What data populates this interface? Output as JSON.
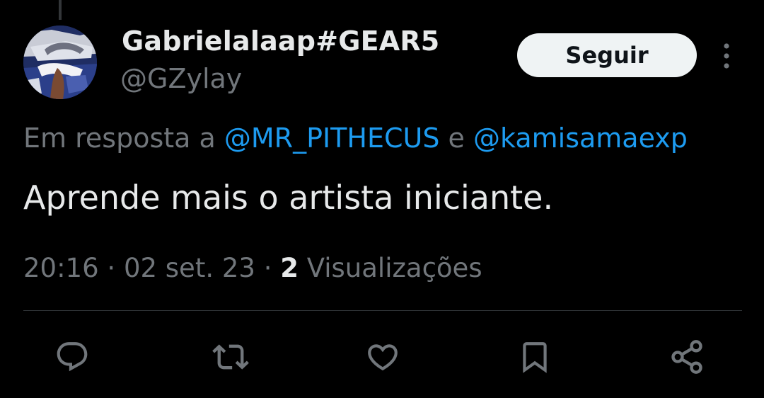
{
  "author": {
    "display_name": "Gabrielalaap#GEAR5",
    "handle": "@GZylay",
    "avatar_icon": "avatar-image"
  },
  "header": {
    "follow_label": "Seguir",
    "more_icon": "more-vertical-icon"
  },
  "reply_context": {
    "prefix": "Em resposta a ",
    "mention_1": "@MR_PITHECUS",
    "conjunction": " e ",
    "mention_2": "@kamisamaexp"
  },
  "tweet": {
    "text": "Aprende mais o artista iniciante."
  },
  "meta": {
    "time": "20:16",
    "separator": " · ",
    "date": "02 set. 23",
    "views_count": "2",
    "views_label": " Visualizações"
  },
  "actions": [
    {
      "name": "reply",
      "icon": "reply-icon"
    },
    {
      "name": "retweet",
      "icon": "retweet-icon"
    },
    {
      "name": "like",
      "icon": "heart-icon"
    },
    {
      "name": "bookmark",
      "icon": "bookmark-icon"
    },
    {
      "name": "share",
      "icon": "share-icon"
    }
  ],
  "colors": {
    "background": "#000000",
    "primary_text": "#e7e9ea",
    "secondary_text": "#71767b",
    "accent": "#1d9bf0",
    "follow_button_bg": "#eff3f4",
    "divider": "#2f3336"
  }
}
